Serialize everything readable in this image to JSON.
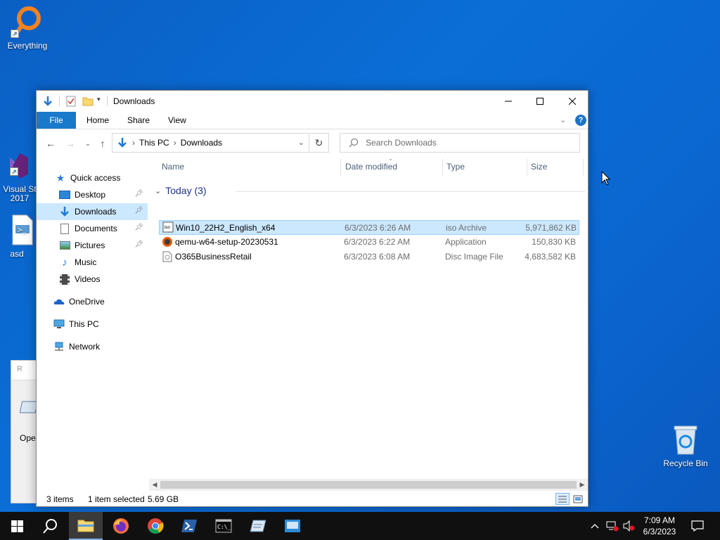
{
  "desktop": {
    "icons": [
      {
        "label": "Everything"
      },
      {
        "label": "Visual St 2017"
      },
      {
        "label": "asd"
      },
      {
        "label": "Recycle Bin"
      }
    ],
    "background_window": {
      "title": "R",
      "text": "Ope"
    }
  },
  "explorer": {
    "title": "Downloads",
    "ribbon_tabs": [
      "File",
      "Home",
      "Share",
      "View"
    ],
    "breadcrumb": [
      "This PC",
      "Downloads"
    ],
    "search_placeholder": "Search Downloads",
    "sidebar": {
      "quick_access": "Quick access",
      "items": [
        "Desktop",
        "Downloads",
        "Documents",
        "Pictures",
        "Music",
        "Videos"
      ],
      "onedrive": "OneDrive",
      "this_pc": "This PC",
      "network": "Network"
    },
    "columns": {
      "name": "Name",
      "date": "Date modified",
      "type": "Type",
      "size": "Size"
    },
    "group": "Today (3)",
    "files": [
      {
        "name": "Win10_22H2_English_x64",
        "date": "6/3/2023 6:26 AM",
        "type": "iso Archive",
        "size": "5,971,862 KB",
        "icon": "iso-archive-icon"
      },
      {
        "name": "qemu-w64-setup-20230531",
        "date": "6/3/2023 6:22 AM",
        "type": "Application",
        "size": "150,830 KB",
        "icon": "qemu-app-icon"
      },
      {
        "name": "O365BusinessRetail",
        "date": "6/3/2023 6:08 AM",
        "type": "Disc Image File",
        "size": "4,683,582 KB",
        "icon": "disc-image-icon"
      }
    ],
    "status": {
      "items": "3 items",
      "selected": "1 item selected",
      "size": "5.69 GB"
    }
  },
  "taskbar": {
    "time": "7:09 AM",
    "date": "6/3/2023"
  },
  "colors": {
    "accent": "#1979ca",
    "selection": "#cce8ff",
    "desktop": "#0a6ed6",
    "taskbar": "#101010"
  }
}
